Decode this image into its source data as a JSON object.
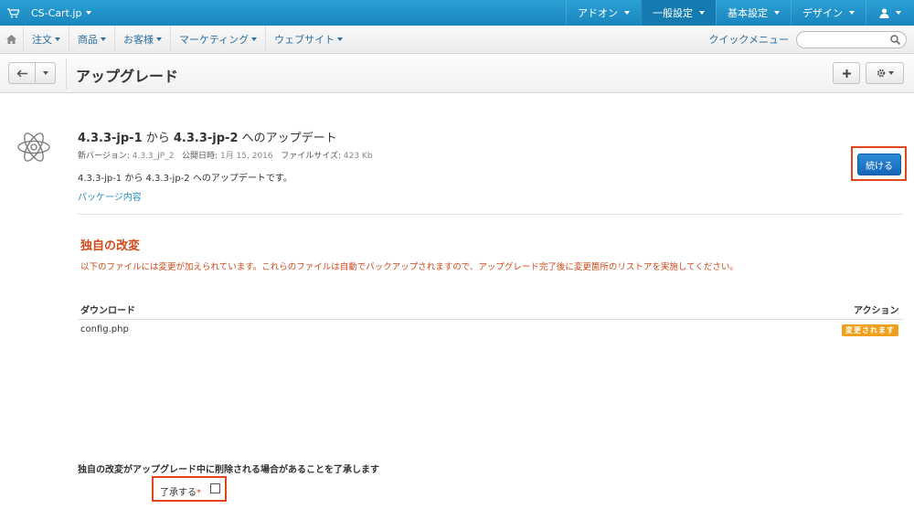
{
  "topbar": {
    "store": "CS-Cart.jp",
    "menus": [
      {
        "label": "アドオン",
        "active": false
      },
      {
        "label": "一般設定",
        "active": true
      },
      {
        "label": "基本設定",
        "active": false
      },
      {
        "label": "デザイン",
        "active": false
      }
    ]
  },
  "navbar": {
    "items": [
      "注文",
      "商品",
      "お客様",
      "マーケティング",
      "ウェブサイト"
    ],
    "quick_menu": "クイックメニュー"
  },
  "page": {
    "title": "アップグレード"
  },
  "package": {
    "title_from": "4.3.3-jp-1",
    "title_mid": " から ",
    "title_to": "4.3.3-jp-2",
    "title_suffix": " へのアップデート",
    "new_version_label": "新バージョン:",
    "new_version": "4.3.3_JP_2",
    "release_label": "公開日時:",
    "release_date": "1月 15, 2016",
    "size_label": "ファイルサイズ:",
    "size": "423 Kb",
    "description": "4.3.3-jp-1 から 4.3.3-jp-2 へのアップデートです。",
    "contents_link": "パッケージ内容",
    "continue_button": "続ける"
  },
  "custom_changes": {
    "title": "独自の改変",
    "message": "以下のファイルには変更が加えられています。これらのファイルは自動でバックアップされますので、アップグレード完了後に変更箇所のリストアを実施してください。",
    "col_download": "ダウンロード",
    "col_action": "アクション",
    "rows": [
      {
        "file": "config.php",
        "action": "変更されます"
      }
    ]
  },
  "confirmation": {
    "text": "独自の改変がアップグレード中に削除される場合があることを了承します",
    "agree_label": "了承する",
    "required_mark": "*"
  },
  "colors": {
    "topbar": "#1a86bf",
    "warning": "#d2491a",
    "badge": "#f0a01a",
    "primary_button": "#1666b7",
    "highlight_box": "#e0451d"
  }
}
